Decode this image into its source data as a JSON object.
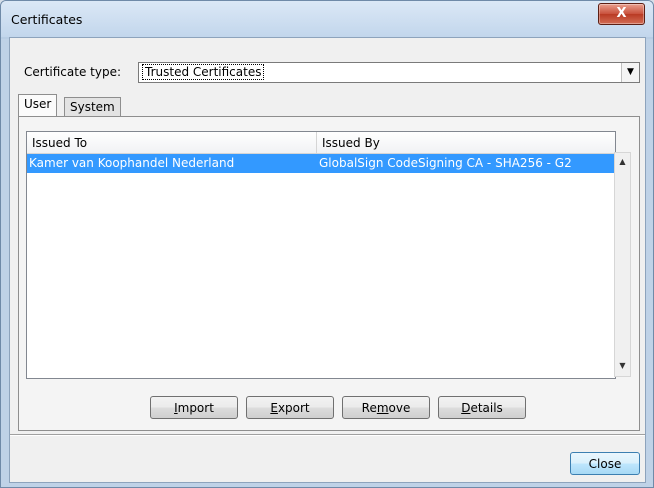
{
  "window": {
    "title": "Certificates",
    "close_glyph": "X"
  },
  "cert_type": {
    "label": "Certificate type:",
    "value": "Trusted Certificates",
    "dropdown_glyph": "▼"
  },
  "tabs": [
    {
      "label": "User",
      "active": true
    },
    {
      "label": "System",
      "active": false
    }
  ],
  "table": {
    "columns": [
      "Issued To",
      "Issued By"
    ],
    "rows": [
      {
        "issued_to": "Kamer van Koophandel Nederland",
        "issued_by": "GlobalSign CodeSigning CA - SHA256 - G2",
        "selected": true
      }
    ]
  },
  "scrollbar": {
    "up_glyph": "▲",
    "down_glyph": "▼"
  },
  "buttons": {
    "import": {
      "mnemonic": "I",
      "rest": "mport"
    },
    "export": {
      "mnemonic": "E",
      "rest": "xport"
    },
    "remove": {
      "pre": "Re",
      "mnemonic": "m",
      "post": "ove"
    },
    "details": {
      "mnemonic": "D",
      "rest": "etails"
    },
    "close": "Close"
  },
  "colors": {
    "selection": "#3399ff",
    "titlebar": "#c4d6ea",
    "close_button": "#c8503b"
  },
  "icons": {
    "dropdown": "chevron-down-icon",
    "close": "close-icon",
    "scroll_up": "scroll-up-icon",
    "scroll_down": "scroll-down-icon"
  }
}
